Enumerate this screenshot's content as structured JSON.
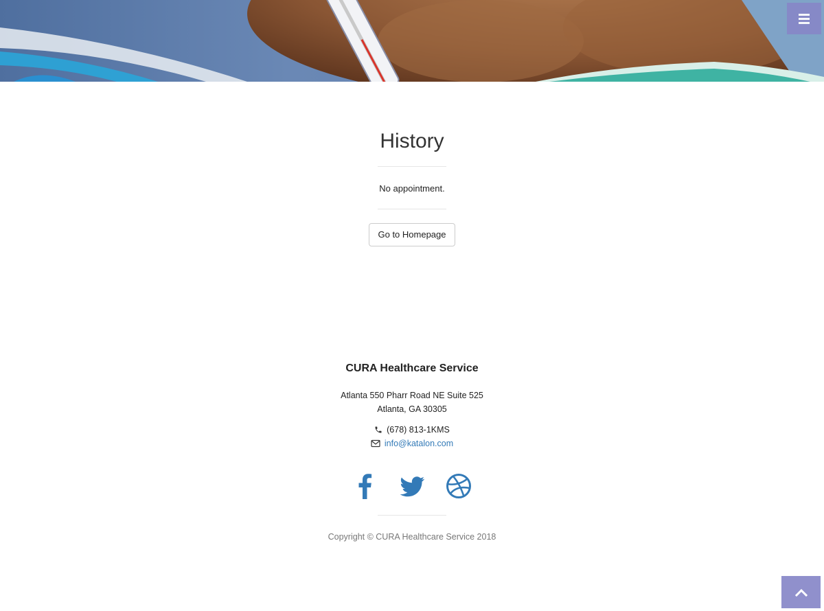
{
  "header": {
    "menu_icon": "bars-icon"
  },
  "main": {
    "title": "History",
    "message": "No appointment.",
    "home_button_label": "Go to Homepage"
  },
  "footer": {
    "company": "CURA Healthcare Service",
    "address_line1": "Atlanta 550 Pharr Road NE Suite 525",
    "address_line2": "Atlanta, GA 30305",
    "phone": "(678) 813-1KMS",
    "email": "info@katalon.com",
    "social": [
      "facebook-icon",
      "twitter-icon",
      "dribbble-icon"
    ],
    "copyright": "Copyright © CURA Healthcare Service 2018"
  },
  "colors": {
    "accent": "#8787c8",
    "link": "#337ab7",
    "divider": "#e6e6e6"
  },
  "back_to_top_icon": "chevron-up-icon"
}
